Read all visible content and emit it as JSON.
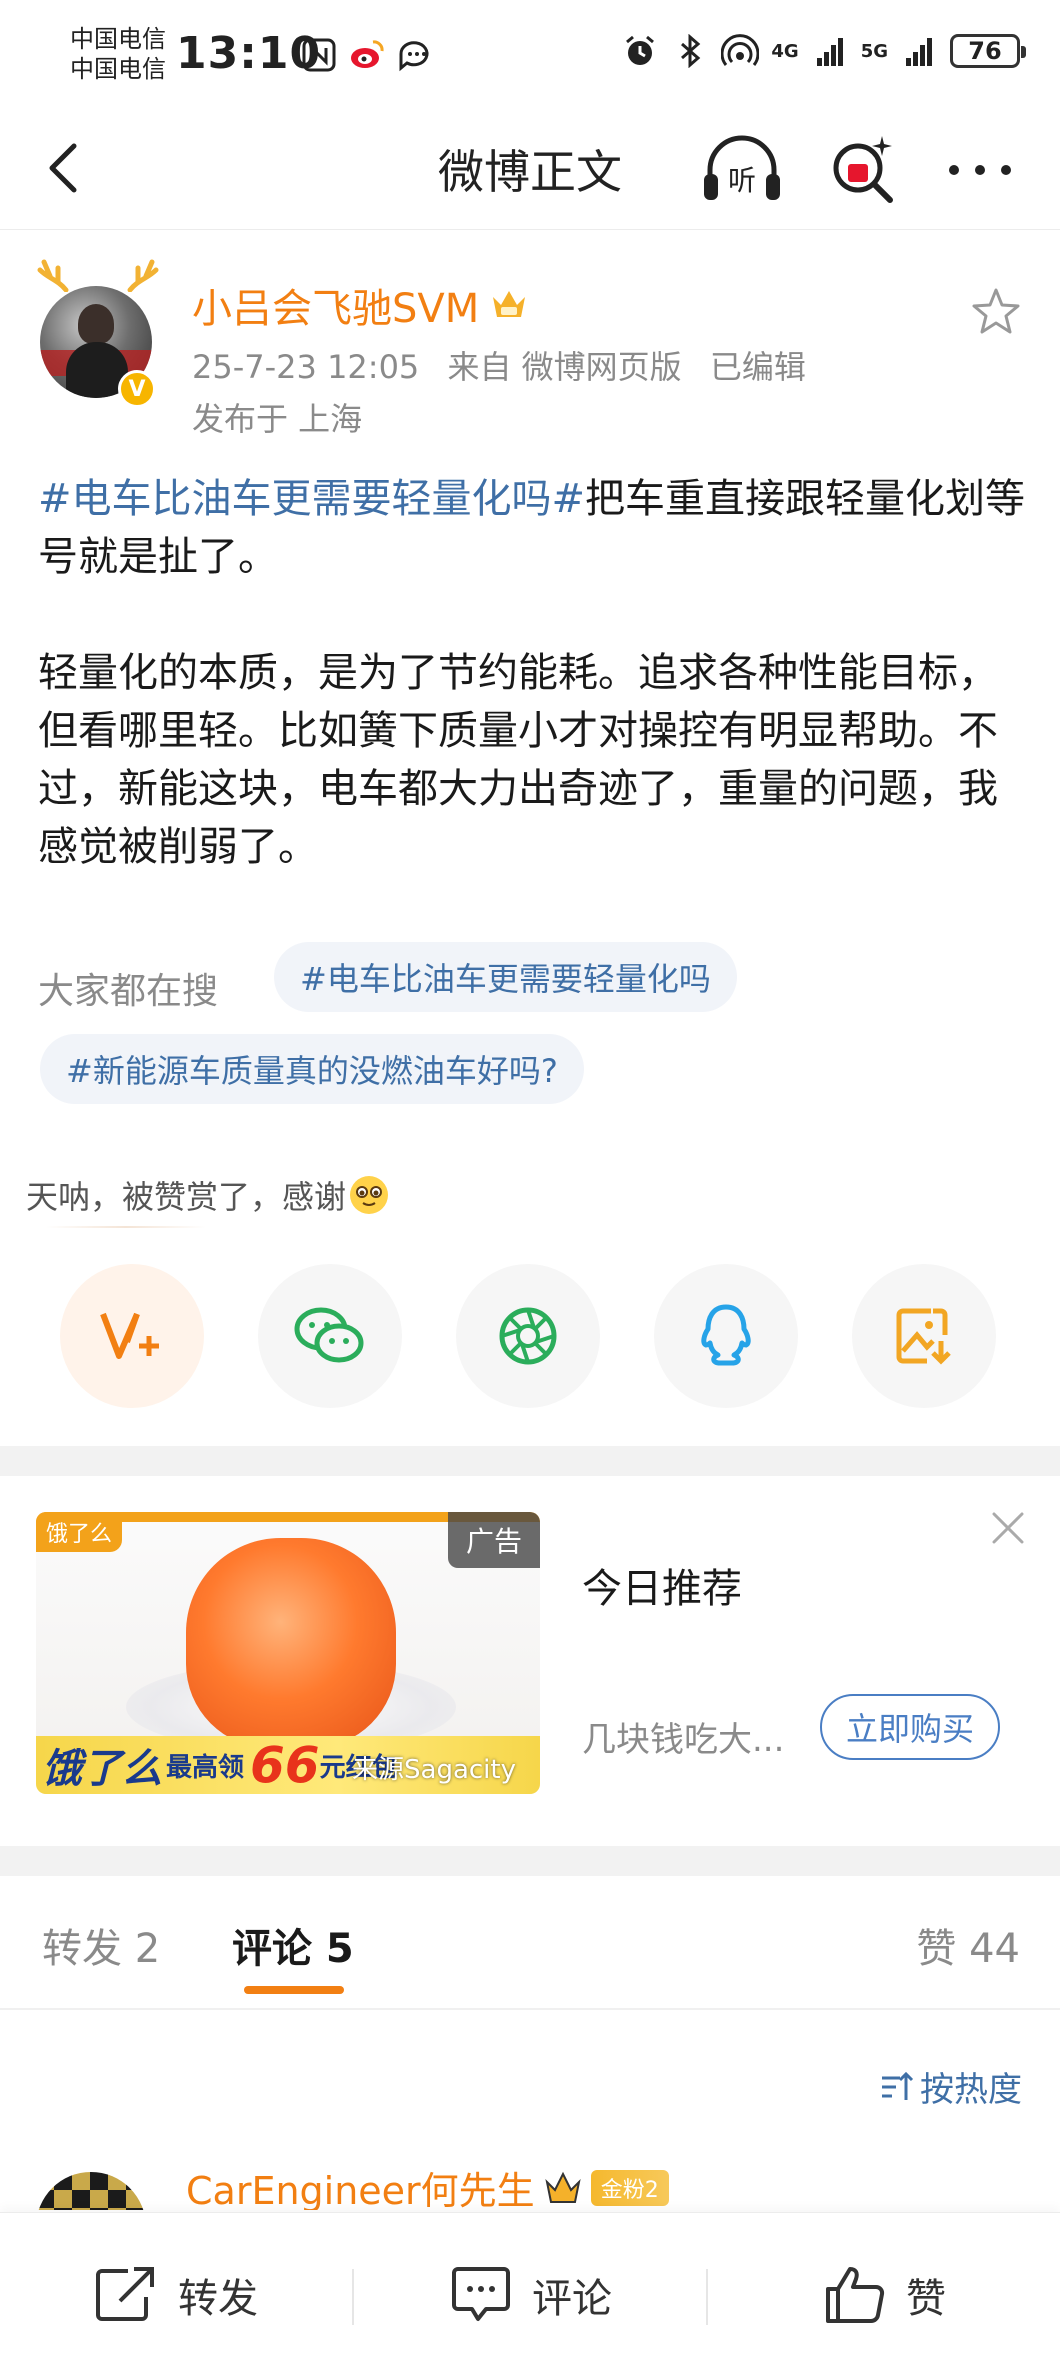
{
  "status_bar": {
    "carrier_1": "中国电信",
    "carrier_2": "中国电信",
    "time": "13:10",
    "net_1": "4G",
    "net_2": "5G",
    "battery": "76"
  },
  "nav": {
    "title": "微博正文",
    "listen_icon": "headphones-listen-icon",
    "search_icon": "search-icon"
  },
  "post": {
    "username": "小吕会飞驰SVM",
    "timestamp": "25-7-23 12:05",
    "source": "来自 微博网页版",
    "edited": "已编辑",
    "location": "发布于 上海",
    "topic": "#电车比油车更需要轻量化吗#",
    "text_1": "把车重直接跟轻量化划等号就是扯了。",
    "text_2": "轻量化的本质，是为了节约能耗。追求各种性能目标，但看哪里轻。比如簧下质量小才对操控有明显帮助。不过，新能这块，电车都大力出奇迹了，重量的问题，我感觉被削弱了。",
    "search_label": "大家都在搜",
    "chips": [
      "#电车比油车更需要轻量化吗",
      "#新能源车质量真的没燃油车好吗?"
    ],
    "reward_tip": "天呐，被赞赏了，感谢",
    "share_buttons": [
      "reward-v-icon",
      "wechat-icon",
      "moments-icon",
      "qq-icon",
      "save-image-icon"
    ]
  },
  "ad": {
    "brand_tag": "饿了么",
    "banner_main": "饿了么",
    "banner_sub": "最高领",
    "banner_num": "66",
    "banner_unit": "元红包",
    "source": "来源Sagacity",
    "label": "广告",
    "title": "今日推荐",
    "desc": "几块钱吃大...",
    "buy": "立即购买"
  },
  "tabs": {
    "repost": "转发 2",
    "comment": "评论 5",
    "likes": "赞 44"
  },
  "sort_label": "按热度",
  "comment_peek": {
    "name": "CarEngineer何先生",
    "fan_badge": "金粉2"
  },
  "bottom_bar": {
    "repost": "转发",
    "comment": "评论",
    "like": "赞"
  },
  "colors": {
    "accent_orange": "#f27f12",
    "topic_blue": "#3f6fa6"
  }
}
